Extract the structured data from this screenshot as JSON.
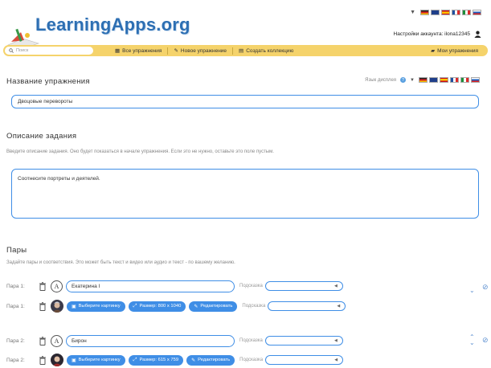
{
  "header": {
    "logo_text": "LearningApps.org",
    "account_text": "Настройки аккаунта: ilona12345"
  },
  "flags": [
    "#cc2222",
    "#1f4fa0",
    "#f1bf00",
    "#1e8f3a",
    "#dd2a2a",
    "#1f5fbf"
  ],
  "nav": {
    "search_placeholder": "Поиск",
    "all_exercises": "Все упражнения",
    "new_exercise": "Новое упражнение",
    "create_collection": "Создать коллекцию",
    "my_exercises": "Мои упражнения"
  },
  "title_section": {
    "heading": "Название упражнения",
    "lang_label": "Язык дисплея",
    "value": "Двоцовые перевороты"
  },
  "task_section": {
    "heading": "Описание задания",
    "hint": "Введите описание задания. Оно будет показаться в начале упражнения. Если это не нужно, оставьте это поле пустым.",
    "value": "Соотнесите портреты и деятелей."
  },
  "pairs_section": {
    "heading": "Пары",
    "hint": "Задайте пары и соответствия. Это может быть текст и видео или аудио и текст - по вашему желанию.",
    "hint_label": "Подсказка",
    "pairs": [
      {
        "label_1": "Пара 1:",
        "text_value": "Екатерина I",
        "label_2": "Пара 1:",
        "choose_image": "Выберите картинку",
        "size": "Размер: 800 x 1040",
        "edit": "Редактировать"
      },
      {
        "label_1": "Пара 2:",
        "text_value": "Бирон",
        "label_2": "Пара 2:",
        "choose_image": "Выберите картинку",
        "size": "Размер: 615 x 759",
        "edit": "Редактировать"
      }
    ]
  }
}
